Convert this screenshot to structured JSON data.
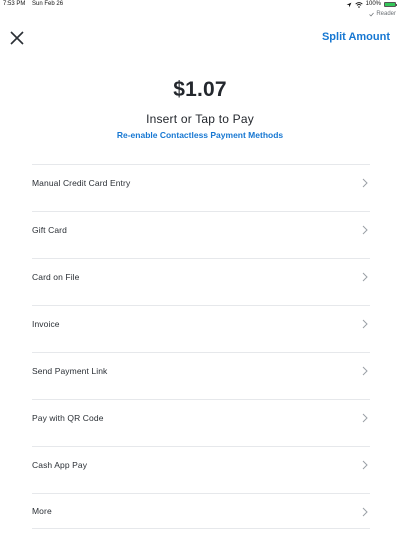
{
  "status_bar": {
    "time": "7:53 PM",
    "date": "Sun Feb 26",
    "battery_text": "100%",
    "battery_level": 1.0,
    "reader_text": "Reader"
  },
  "header": {
    "close_icon": "close-icon",
    "split_label": "Split Amount"
  },
  "payment": {
    "amount": "$1.07",
    "prompt": "Insert or Tap to Pay",
    "reenable_label": "Re-enable Contactless Payment Methods"
  },
  "methods": [
    {
      "label": "Manual Credit Card Entry"
    },
    {
      "label": "Gift Card"
    },
    {
      "label": "Card on File"
    },
    {
      "label": "Invoice"
    },
    {
      "label": "Send Payment Link"
    },
    {
      "label": "Pay with QR Code"
    },
    {
      "label": "Cash App Pay"
    },
    {
      "label": "More"
    }
  ],
  "colors": {
    "accent": "#1677d2",
    "text": "#23272d",
    "divider": "#e6e8eb",
    "battery": "#34c759"
  }
}
